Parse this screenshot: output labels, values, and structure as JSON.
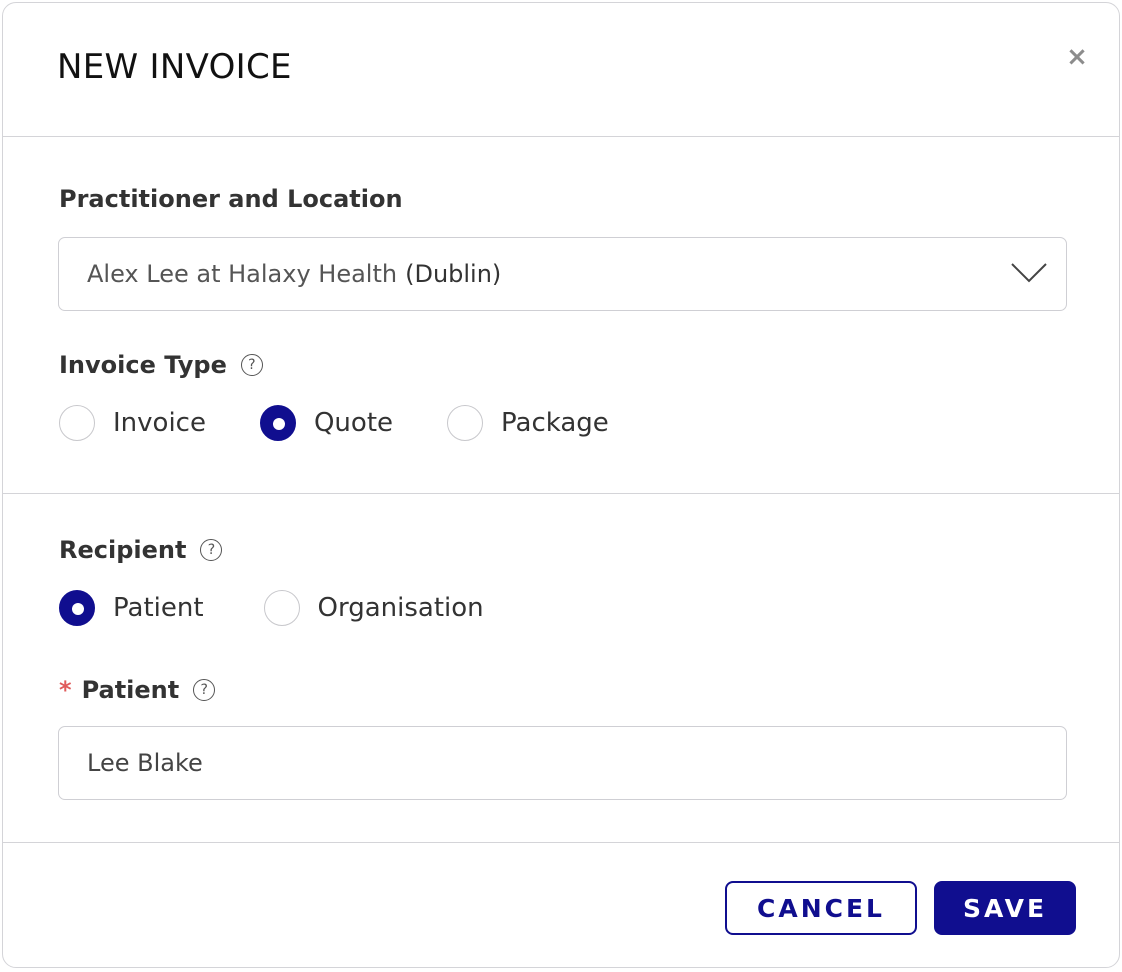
{
  "dialog": {
    "title": "NEW INVOICE",
    "close_icon": "close-icon",
    "close_glyph": "×"
  },
  "practitioner": {
    "label": "Practitioner and Location",
    "selected_name": "Alex Lee at Halaxy Health",
    "selected_location": "(Dublin)"
  },
  "invoice_type": {
    "label": "Invoice Type",
    "help_glyph": "?",
    "options": [
      {
        "label": "Invoice",
        "checked": false
      },
      {
        "label": "Quote",
        "checked": true
      },
      {
        "label": "Package",
        "checked": false
      }
    ]
  },
  "recipient": {
    "label": "Recipient",
    "help_glyph": "?",
    "options": [
      {
        "label": "Patient",
        "checked": true
      },
      {
        "label": "Organisation",
        "checked": false
      }
    ]
  },
  "patient": {
    "required_mark": "*",
    "label": "Patient",
    "help_glyph": "?",
    "value": "Lee Blake"
  },
  "footer": {
    "cancel_label": "CANCEL",
    "save_label": "SAVE"
  },
  "colors": {
    "accent": "#100e8f",
    "required": "#e05a5a",
    "border": "#d4d4d8"
  }
}
